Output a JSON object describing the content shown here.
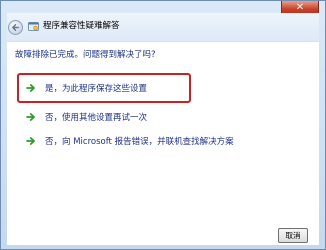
{
  "window": {
    "title": "程序兼容性疑难解答",
    "close_label": "✕"
  },
  "content": {
    "status": "故障排除已完成。问题得到解决了吗?",
    "options": [
      {
        "label": "是，为此程序保存这些设置",
        "highlighted": true
      },
      {
        "label": "否，使用其他设置再试一次",
        "highlighted": false
      },
      {
        "label": "否，向 Microsoft 报告错误，并联机查找解决方案",
        "highlighted": false
      }
    ]
  },
  "footer": {
    "cancel_label": "取消"
  },
  "colors": {
    "link_text": "#1e3287",
    "arrow_green": "#2e9c2e",
    "highlight_red": "#cc1f1f"
  },
  "icons": {
    "back": "back-arrow-icon",
    "app": "compatibility-icon",
    "option": "green-arrow-icon"
  }
}
